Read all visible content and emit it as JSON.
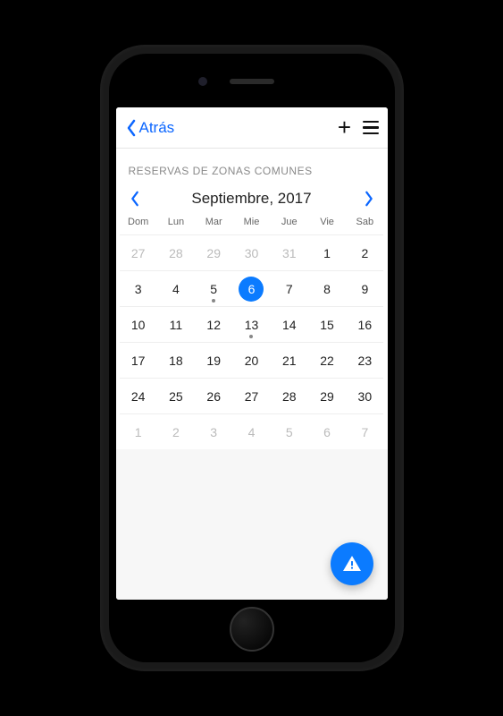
{
  "nav": {
    "back_label": "Atrás"
  },
  "section_title": "RESERVAS DE ZONAS COMUNES",
  "month_label": "Septiembre, 2017",
  "weekdays": [
    "Dom",
    "Lun",
    "Mar",
    "Mie",
    "Jue",
    "Vie",
    "Sab"
  ],
  "weeks": [
    [
      {
        "d": "27",
        "other": true
      },
      {
        "d": "28",
        "other": true
      },
      {
        "d": "29",
        "other": true
      },
      {
        "d": "30",
        "other": true
      },
      {
        "d": "31",
        "other": true
      },
      {
        "d": "1"
      },
      {
        "d": "2"
      }
    ],
    [
      {
        "d": "3"
      },
      {
        "d": "4"
      },
      {
        "d": "5",
        "dot": true
      },
      {
        "d": "6",
        "selected": true
      },
      {
        "d": "7"
      },
      {
        "d": "8"
      },
      {
        "d": "9"
      }
    ],
    [
      {
        "d": "10"
      },
      {
        "d": "11"
      },
      {
        "d": "12"
      },
      {
        "d": "13",
        "dot": true
      },
      {
        "d": "14"
      },
      {
        "d": "15"
      },
      {
        "d": "16"
      }
    ],
    [
      {
        "d": "17"
      },
      {
        "d": "18"
      },
      {
        "d": "19"
      },
      {
        "d": "20"
      },
      {
        "d": "21"
      },
      {
        "d": "22"
      },
      {
        "d": "23"
      }
    ],
    [
      {
        "d": "24"
      },
      {
        "d": "25"
      },
      {
        "d": "26"
      },
      {
        "d": "27"
      },
      {
        "d": "28"
      },
      {
        "d": "29"
      },
      {
        "d": "30"
      }
    ],
    [
      {
        "d": "1",
        "other": true
      },
      {
        "d": "2",
        "other": true
      },
      {
        "d": "3",
        "other": true
      },
      {
        "d": "4",
        "other": true
      },
      {
        "d": "5",
        "other": true
      },
      {
        "d": "6",
        "other": true
      },
      {
        "d": "7",
        "other": true
      }
    ]
  ]
}
